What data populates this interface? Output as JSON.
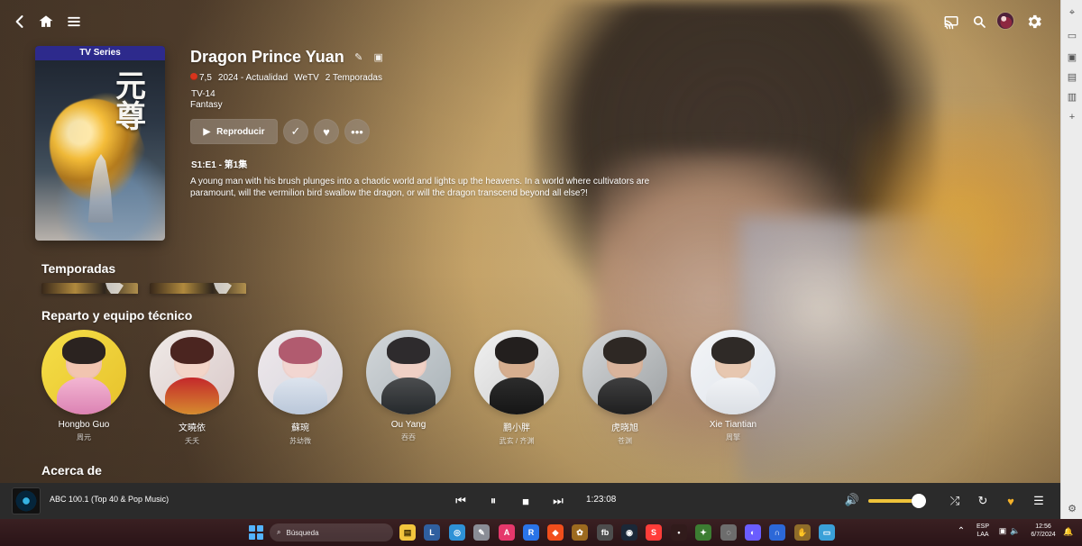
{
  "top_nav": {
    "icons": [
      "back-icon",
      "home-icon",
      "menu-icon",
      "cast-icon",
      "search-icon",
      "user-avatar",
      "settings-icon"
    ]
  },
  "poster": {
    "badge": "TV Series",
    "title_art": "元尊"
  },
  "show": {
    "title": "Dragon Prince Yuan",
    "rating": "7,5",
    "years": "2024 - Actualidad",
    "network": "WeTV",
    "seasons": "2 Temporadas",
    "content_rating": "TV-14",
    "genre": "Fantasy",
    "episode": "S1:E1 - 第1集",
    "description": "A young man with his brush plunges into a chaotic world and lights up the heavens. In a world where cultivators are paramount, will the vermilion bird swallow the dragon, or will the dragon transcend beyond all else?!"
  },
  "actions": {
    "play_label": "Reproducir"
  },
  "sections": {
    "seasons": "Temporadas",
    "cast": "Reparto y equipo técnico",
    "about": "Acerca de"
  },
  "cast": [
    {
      "name": "Hongbo Guo",
      "role": "周元"
    },
    {
      "name": "文曉依",
      "role": "夭夭"
    },
    {
      "name": "蘇琬",
      "role": "苏幼微"
    },
    {
      "name": "Ou Yang",
      "role": "吞吞"
    },
    {
      "name": "鹏小胖",
      "role": "武玄 / 齐渊"
    },
    {
      "name": "虎晓旭",
      "role": "苍渊"
    },
    {
      "name": "Xie Tiantian",
      "role": "周擎"
    }
  ],
  "player": {
    "station": "ABC 100.1 (Top 40 & Pop Music)",
    "time": "1:23:08",
    "volume_level": 0.88
  },
  "taskbar": {
    "search_placeholder": "Búsqueda",
    "language_top": "ESP",
    "language_bottom": "LAA",
    "time": "12:56",
    "date": "6/7/2024"
  },
  "colors": {
    "accent_yellow": "#efc33a",
    "favorite_orange": "#f4b129",
    "player_bg": "#2b2b2b"
  }
}
